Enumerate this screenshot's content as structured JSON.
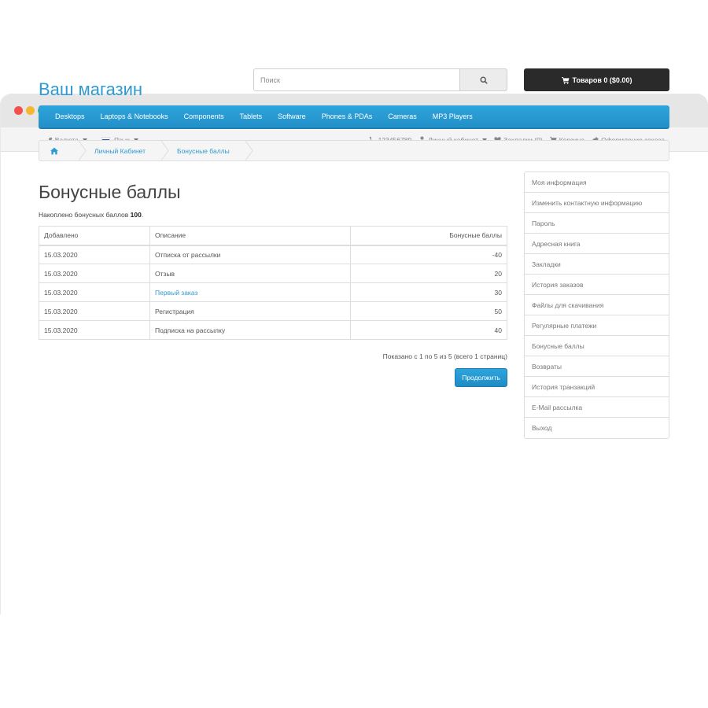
{
  "topbar": {
    "currency_label": "Валюта",
    "currency_symbol": "$",
    "language_label": "Язык",
    "phone": "123456789",
    "account": "Личный кабинет",
    "wishlist": "Закладки (0)",
    "cart": "Корзина",
    "checkout": "Оформление заказа"
  },
  "header": {
    "logo": "Ваш магазин",
    "search_placeholder": "Поиск",
    "cart_button": "Товаров 0 ($0.00)"
  },
  "nav": {
    "items": [
      "Desktops",
      "Laptops & Notebooks",
      "Components",
      "Tablets",
      "Software",
      "Phones & PDAs",
      "Cameras",
      "MP3 Players"
    ]
  },
  "breadcrumb": {
    "items": [
      "Личный Кабинет",
      "Бонусные баллы"
    ]
  },
  "main": {
    "title": "Бонусные баллы",
    "points_prefix": "Накоплено бонусных баллов",
    "points_value": "100",
    "points_suffix": ".",
    "table": {
      "headers": [
        "Добавлено",
        "Описание",
        "Бонусные баллы"
      ],
      "rows": [
        {
          "date": "15.03.2020",
          "description": "Отписка от рассылки",
          "points": "-40",
          "link": false
        },
        {
          "date": "15.03.2020",
          "description": "Отзыв",
          "points": "20",
          "link": false
        },
        {
          "date": "15.03.2020",
          "description": "Первый заказ",
          "points": "30",
          "link": true
        },
        {
          "date": "15.03.2020",
          "description": "Регистрация",
          "points": "50",
          "link": false
        },
        {
          "date": "15.03.2020",
          "description": "Подписка на рассылку",
          "points": "40",
          "link": false
        }
      ]
    },
    "pagination_text": "Показано с 1 по 5 из 5 (всего 1 страниц)",
    "continue_button": "Продолжить"
  },
  "sidebar": {
    "items": [
      "Моя информация",
      "Изменить контактную информацию",
      "Пароль",
      "Адресная книга",
      "Закладки",
      "История заказов",
      "Файлы для скачивания",
      "Регулярные платежи",
      "Бонусные баллы",
      "Возвраты",
      "История транзакций",
      "E-Mail рассылка",
      "Выход"
    ]
  },
  "colors": {
    "accent": "#2d9ad3",
    "nav_bg": "#2390c8",
    "cart_bg": "#2a2a2a"
  }
}
